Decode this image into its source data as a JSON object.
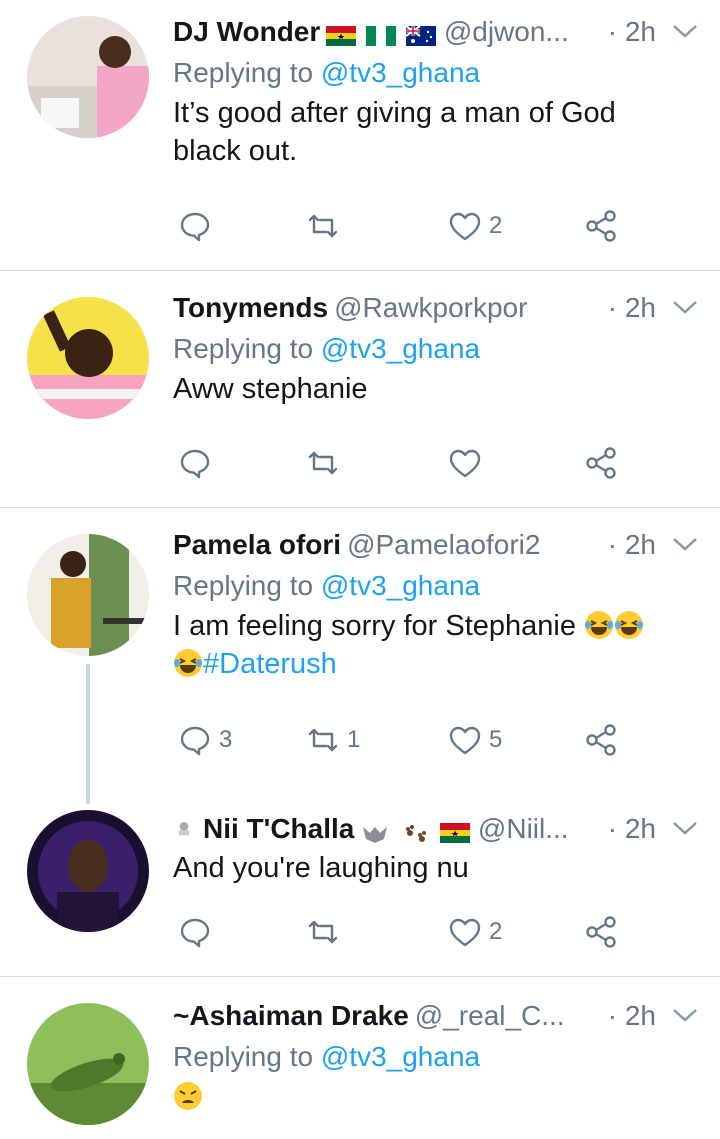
{
  "tweets": [
    {
      "name": "DJ Wonder",
      "handle": "@djwon...",
      "time": "· 2h",
      "replying_prefix": "Replying to",
      "replying_to": "@tv3_ghana",
      "text": "It’s good after giving a man of God black out.",
      "reply_count": "",
      "retweet_count": "",
      "like_count": "2"
    },
    {
      "name": "Tonymends",
      "handle": "@Rawkporkpor",
      "time": "· 2h",
      "replying_prefix": "Replying to",
      "replying_to": "@tv3_ghana",
      "text": "Aww stephanie",
      "reply_count": "",
      "retweet_count": "",
      "like_count": ""
    },
    {
      "name": "Pamela ofori",
      "handle": "@Pamelaofori2",
      "time": "· 2h",
      "replying_prefix": "Replying to",
      "replying_to": "@tv3_ghana",
      "text": "I am feeling sorry for Stephanie",
      "hashtag": "#Daterush",
      "reply_count": "3",
      "retweet_count": "1",
      "like_count": "5"
    },
    {
      "name": "Nii T'Challa",
      "handle": "@Niil...",
      "time": "· 2h",
      "text": "And you're laughing nu",
      "reply_count": "",
      "retweet_count": "",
      "like_count": "2"
    },
    {
      "name": "~Ashaiman Drake",
      "handle": "@_real_C...",
      "time": "· 2h",
      "replying_prefix": "Replying to",
      "replying_to": "@tv3_ghana",
      "text": ""
    }
  ],
  "icons": {
    "reply": "reply-icon",
    "retweet": "retweet-icon",
    "like": "heart-icon",
    "share": "share-icon",
    "more": "chevron-down-icon"
  },
  "colors": {
    "link": "#1da1f2",
    "secondary": "#657786",
    "divider": "#d8dde1",
    "thread": "#ccd6dd"
  }
}
